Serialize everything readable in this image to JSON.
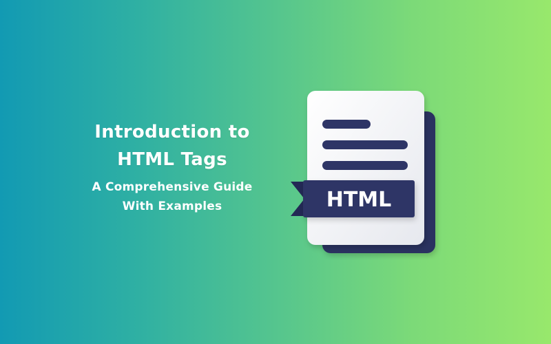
{
  "banner": {
    "title_line1": "Introduction to",
    "title_line2": "HTML Tags",
    "subtitle_line1": "A Comprehensive Guide",
    "subtitle_line2": "With Examples"
  },
  "icon": {
    "name": "html-document-icon",
    "label": "HTML"
  },
  "colors": {
    "gradient_start": "#129ab3",
    "gradient_end": "#98e86c",
    "document_back": "#2b3160",
    "document_front": "#f3f4f7",
    "lines": "#2e3566",
    "ribbon": "#2e3566",
    "text": "#ffffff"
  }
}
